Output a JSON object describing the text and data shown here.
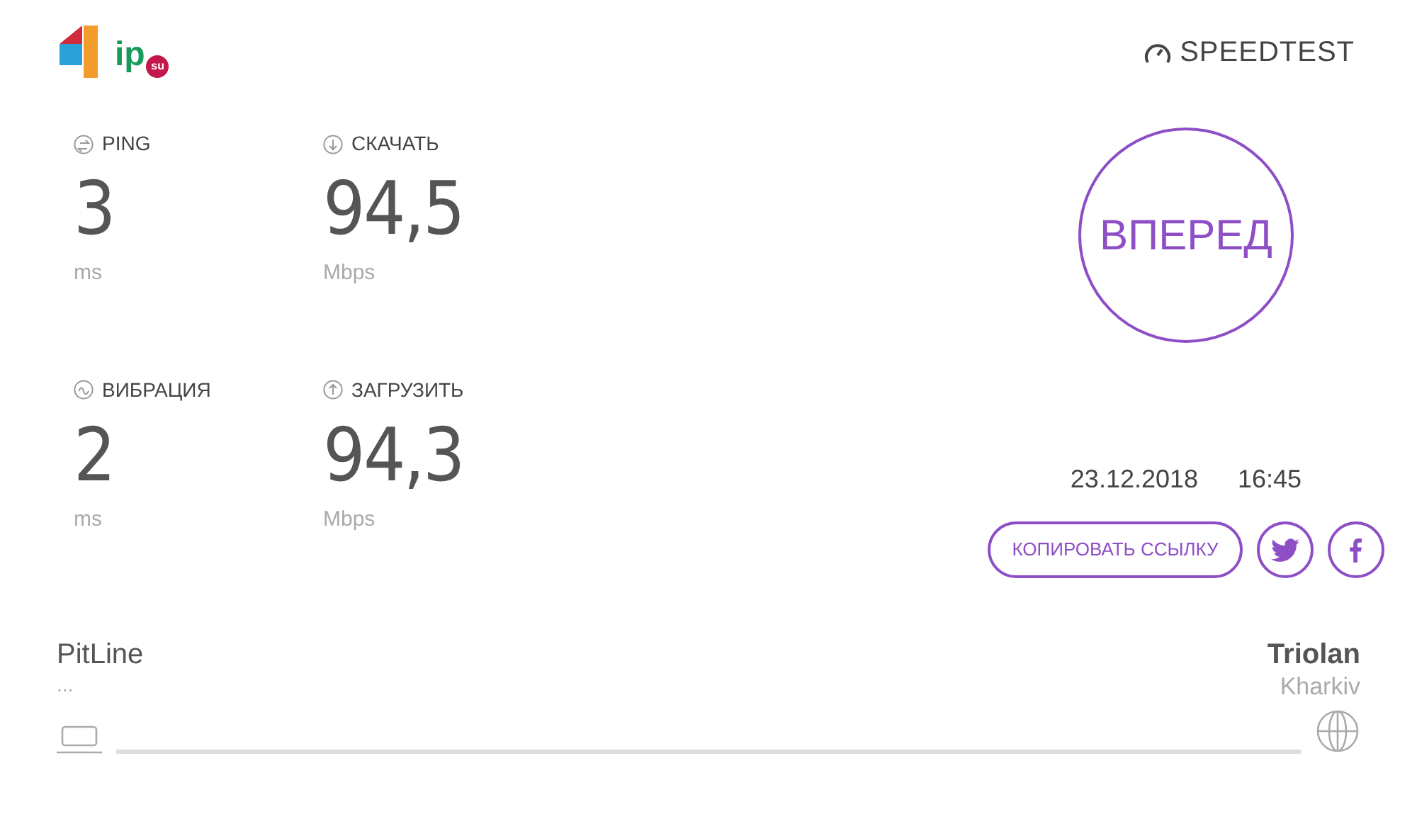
{
  "logo": {
    "text": "ip",
    "badge": "su"
  },
  "brand": "SPEEDTEST",
  "metrics": [
    {
      "kind": "ping",
      "label": "PING",
      "value": "3",
      "unit": "ms"
    },
    {
      "kind": "download",
      "label": "СКАЧАТЬ",
      "value": "94,5",
      "unit": "Mbps"
    },
    {
      "kind": "jitter",
      "label": "ВИБРАЦИЯ",
      "value": "2",
      "unit": "ms"
    },
    {
      "kind": "upload",
      "label": "ЗАГРУЗИТЬ",
      "value": "94,3",
      "unit": "Mbps"
    }
  ],
  "go_button": "ВПЕРЕД",
  "date": "23.12.2018",
  "time": "16:45",
  "copy_link_button": "КОПИРОВАТЬ ССЫЛКУ",
  "share": [
    {
      "kind": "twitter"
    },
    {
      "kind": "facebook"
    }
  ],
  "client": {
    "name": "PitLine",
    "detail": "..."
  },
  "server": {
    "name": "Triolan",
    "location": "Kharkiv"
  }
}
